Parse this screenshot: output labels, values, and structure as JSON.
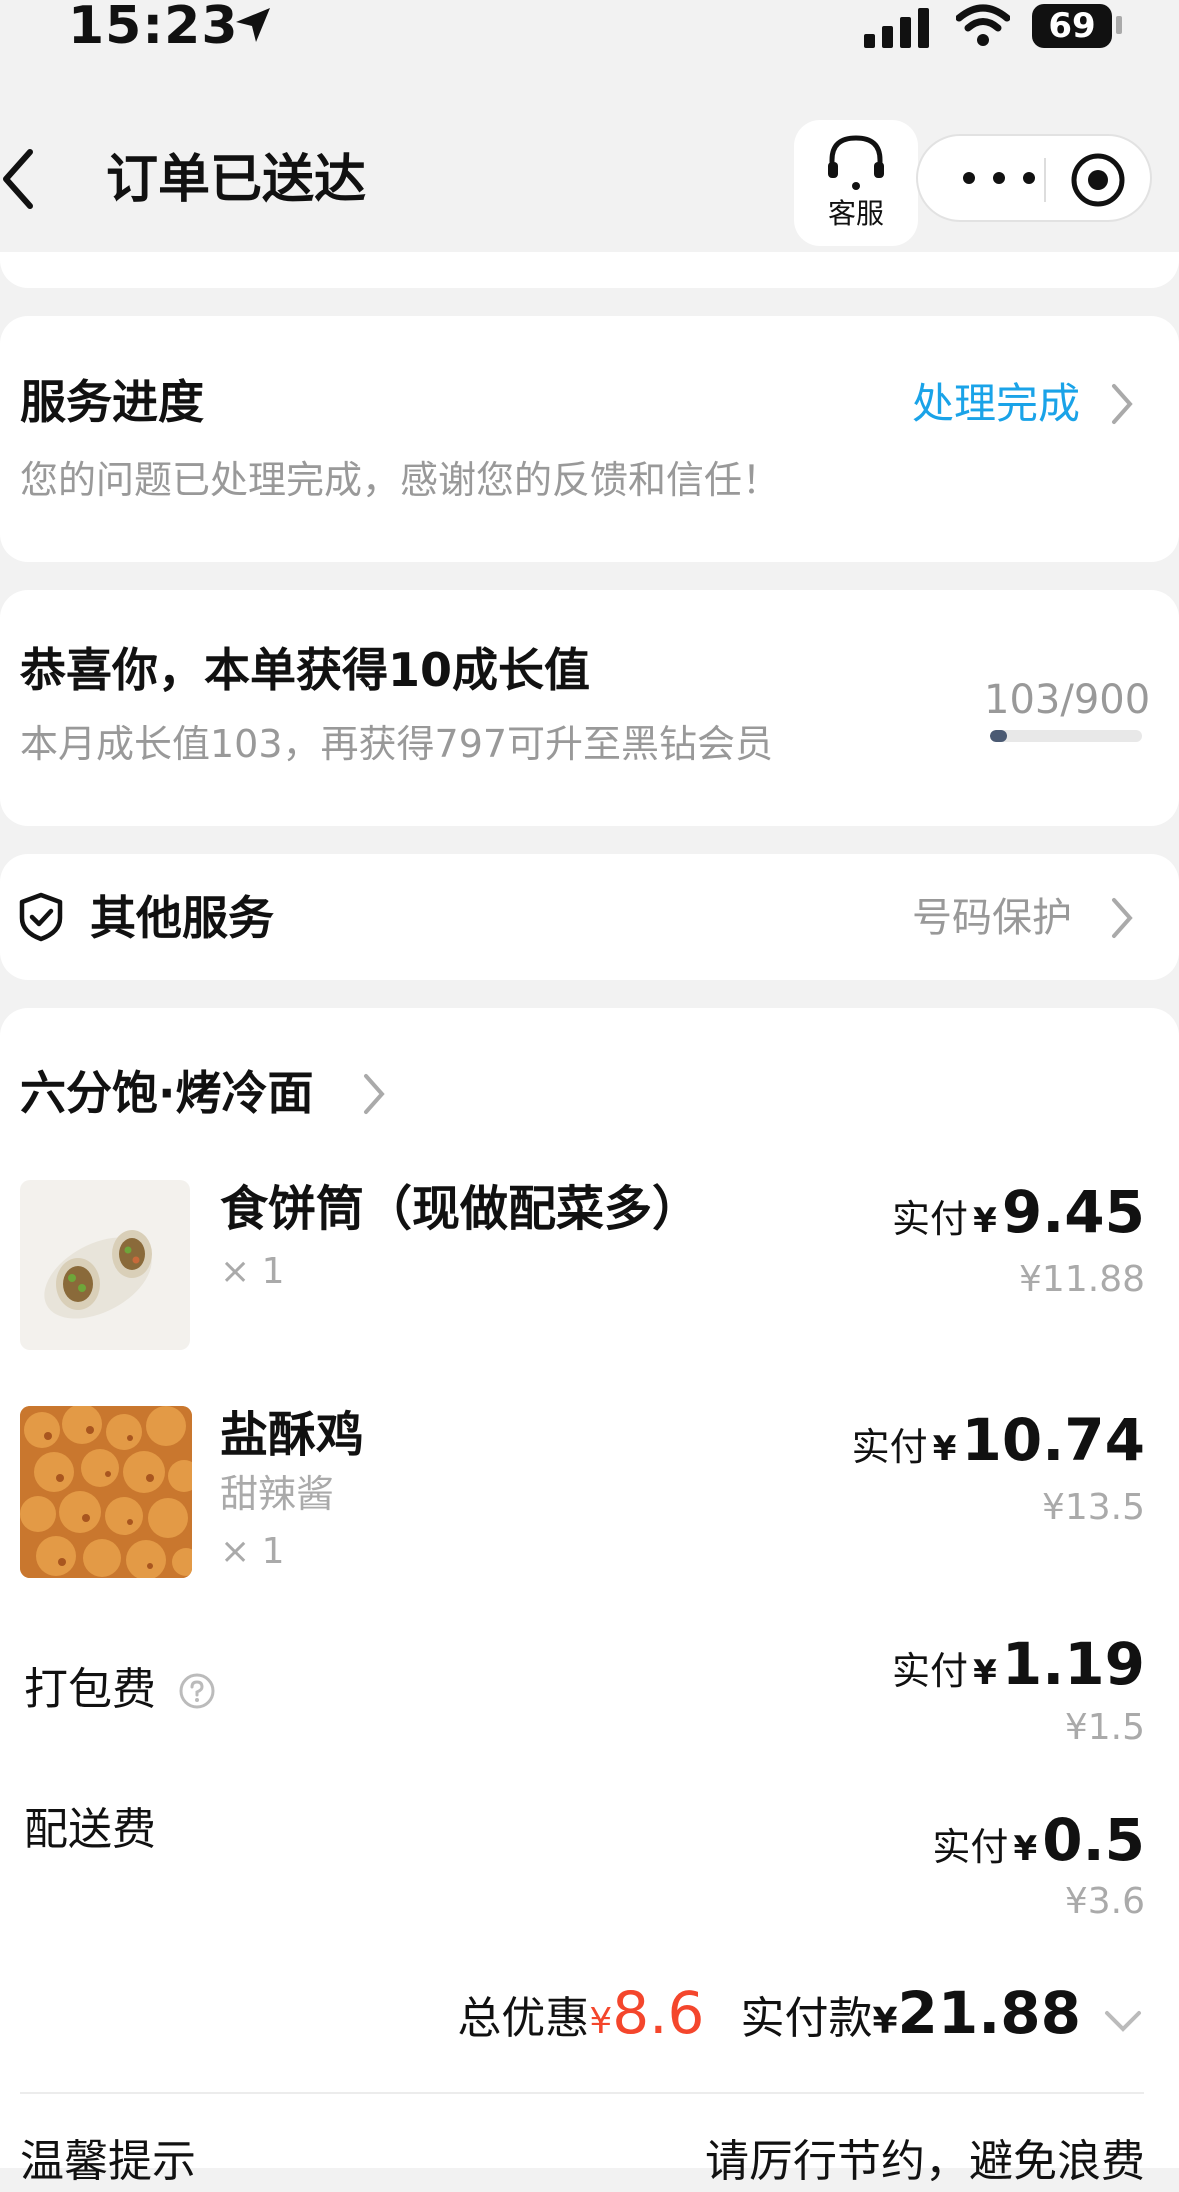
{
  "status_bar": {
    "time": "15:23",
    "battery": "69"
  },
  "header": {
    "title": "订单已送达",
    "customer_service_label": "客服"
  },
  "service_progress": {
    "title": "服务进度",
    "status_link": "处理完成",
    "message": "您的问题已处理完成，感谢您的反馈和信任！"
  },
  "growth": {
    "title": "恭喜你，本单获得10成长值",
    "subtitle": "本月成长值103，再获得797可升至黑钻会员",
    "progress_text": "103/900",
    "progress_fraction": 0.114
  },
  "other_services": {
    "title": "其他服务",
    "link": "号码保护"
  },
  "order": {
    "store_name": "六分饱·烤冷面",
    "items": [
      {
        "name": "食饼筒（现做配菜多）",
        "spec": "",
        "qty": "× 1",
        "paid_label": "实付",
        "currency": "¥",
        "paid": "9.45",
        "original": "¥11.88"
      },
      {
        "name": "盐酥鸡",
        "spec": "甜辣酱",
        "qty": "× 1",
        "paid_label": "实付",
        "currency": "¥",
        "paid": "10.74",
        "original": "¥13.5"
      }
    ],
    "fees": [
      {
        "label": "打包费",
        "paid_label": "实付",
        "currency": "¥",
        "paid": "1.19",
        "original": "¥1.5"
      },
      {
        "label": "配送费",
        "paid_label": "实付",
        "currency": "¥",
        "paid": "0.5",
        "original": "¥3.6"
      }
    ],
    "total": {
      "discount_label": "总优惠",
      "discount_currency": "¥",
      "discount_value": "8.6",
      "paid_label": "实付款",
      "paid_currency": "¥",
      "paid_value": "21.88"
    },
    "tip_left": "温馨提示",
    "tip_right": "请厉行节约，避免浪费"
  },
  "colors": {
    "accent_blue": "#1aa3e8",
    "discount_red": "#f4462c",
    "progress_fill": "#4b5a73"
  }
}
